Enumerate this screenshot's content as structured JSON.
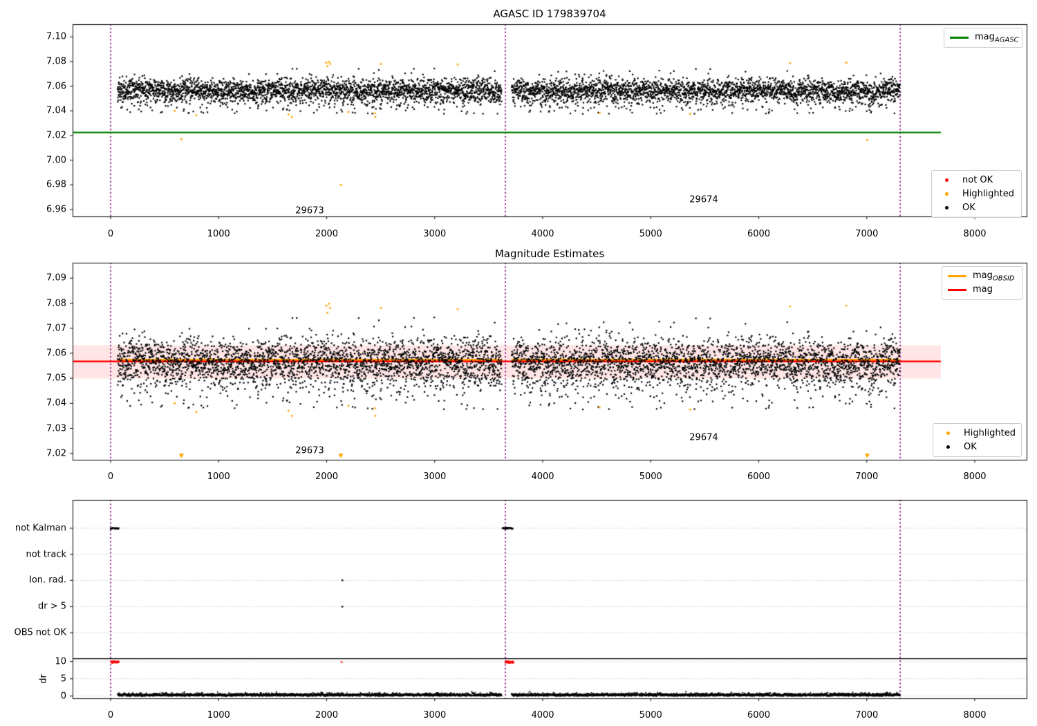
{
  "figure": {
    "titles": {
      "plot1": "AGASC ID 179839704",
      "plot2": "Magnitude Estimates"
    }
  },
  "colors": {
    "agasc_line": "#008000",
    "obsid_line": "#ffa500",
    "mag_line": "#ff0000",
    "vline": "#800080",
    "band": "rgba(255,0,0,0.10)",
    "ok_marker": "#000000",
    "highlighted_marker": "#ffa500",
    "not_ok_marker": "#ff0000",
    "grid": "#b0b0b0"
  },
  "chart_data": [
    {
      "type": "scatter",
      "title": "AGASC ID 179839704",
      "xlim": [
        -352,
        8480
      ],
      "ylim": [
        6.954,
        7.11
      ],
      "xticks": [
        0,
        1000,
        2000,
        3000,
        4000,
        5000,
        6000,
        7000,
        8000
      ],
      "xtick_labels": [
        "0",
        "1000",
        "2000",
        "3000",
        "4000",
        "5000",
        "6000",
        "7000",
        "8000"
      ],
      "yticks": [
        6.96,
        6.98,
        7.0,
        7.02,
        7.04,
        7.06,
        7.08,
        7.1
      ],
      "ytick_labels": [
        "6.96",
        "6.98",
        "7.00",
        "7.02",
        "7.04",
        "7.06",
        "7.08",
        "7.10"
      ],
      "ref_line": {
        "name": "mag_AGASC",
        "y": 7.0225,
        "x_start": -352,
        "x_end": 7686
      },
      "vlines": [
        0,
        3655,
        7310
      ],
      "obsid_annotations": [
        {
          "text": "29673",
          "x": 1843,
          "y": 6.959
        },
        {
          "text": "29674",
          "x": 5491,
          "y": 6.968
        }
      ],
      "scatter": {
        "mean": 7.0565,
        "sigma": 0.0048,
        "y_core_range": [
          7.045,
          7.068
        ],
        "segments": [
          {
            "obsid": "29673",
            "x_range": [
              64,
              3620
            ],
            "n": 2800
          },
          {
            "obsid": "29674",
            "x_range": [
              3712,
              7308
            ],
            "n": 2800
          }
        ]
      },
      "highlighted_points": [
        [
          593,
          7.04
        ],
        [
          655,
          7.017
        ],
        [
          794,
          7.0365
        ],
        [
          1647,
          7.037
        ],
        [
          1679,
          7.035
        ],
        [
          1997,
          7.079
        ],
        [
          2007,
          7.0762
        ],
        [
          2022,
          7.0798
        ],
        [
          2033,
          7.0781
        ],
        [
          2131,
          6.98
        ],
        [
          2202,
          7.039
        ],
        [
          2445,
          7.038
        ],
        [
          2451,
          7.035
        ],
        [
          2502,
          7.078
        ],
        [
          3213,
          7.0776
        ],
        [
          4527,
          7.0384
        ],
        [
          5365,
          7.0375
        ],
        [
          6290,
          7.0787
        ],
        [
          6810,
          7.079
        ],
        [
          7004,
          7.0163
        ]
      ],
      "legend_top": {
        "items": [
          {
            "swatch": "line",
            "color": "#008000",
            "label_main": "mag",
            "label_sub": "AGASC"
          }
        ]
      },
      "legend_bottom": {
        "items": [
          {
            "swatch": "dot",
            "color": "#ff0000",
            "label": "not OK"
          },
          {
            "swatch": "dot",
            "color": "#ffa500",
            "label": "Highlighted"
          },
          {
            "swatch": "dot",
            "color": "#000000",
            "label": "OK"
          }
        ]
      }
    },
    {
      "type": "scatter",
      "title": "Magnitude Estimates",
      "xlim": [
        -352,
        8480
      ],
      "ylim": [
        7.0174,
        7.0962
      ],
      "xticks": [
        0,
        1000,
        2000,
        3000,
        4000,
        5000,
        6000,
        7000,
        8000
      ],
      "xtick_labels": [
        "0",
        "1000",
        "2000",
        "3000",
        "4000",
        "5000",
        "6000",
        "7000",
        "8000"
      ],
      "yticks": [
        7.02,
        7.03,
        7.04,
        7.05,
        7.06,
        7.07,
        7.08,
        7.09
      ],
      "ytick_labels": [
        "7.02",
        "7.03",
        "7.04",
        "7.05",
        "7.06",
        "7.07",
        "7.08",
        "7.09"
      ],
      "mag_line": {
        "name": "mag",
        "y": 7.0567,
        "x_start": -352,
        "x_end": 7686
      },
      "obsid_line": {
        "name": "mag_OBSID",
        "y": 7.0572,
        "segments": [
          [
            64,
            3620
          ],
          [
            3712,
            7308
          ]
        ]
      },
      "band": {
        "y_low": 7.0499,
        "y_high": 7.0632,
        "x_start": -352,
        "x_end": 7686
      },
      "vlines": [
        0,
        3655,
        7310
      ],
      "obsid_annotations": [
        {
          "text": "29673",
          "x": 1843,
          "y": 7.021
        },
        {
          "text": "29674",
          "x": 5491,
          "y": 7.0263
        }
      ],
      "clipped_low_x": [
        655,
        2131,
        7004
      ],
      "legend_top": {
        "items": [
          {
            "swatch": "line",
            "color": "#ffa500",
            "label_main": "mag",
            "label_sub": "OBSID"
          },
          {
            "swatch": "line",
            "color": "#ff0000",
            "label_main": "mag",
            "label_sub": ""
          }
        ]
      },
      "legend_bottom": {
        "items": [
          {
            "swatch": "dot",
            "color": "#ffa500",
            "label": "Highlighted"
          },
          {
            "swatch": "dot",
            "color": "#000000",
            "label": "OK"
          }
        ]
      }
    },
    {
      "type": "flags-and-dr",
      "rows": [
        {
          "label": "not Kalman"
        },
        {
          "label": "not track"
        },
        {
          "label": "Ion. rad."
        },
        {
          "label": "dr > 5"
        },
        {
          "label": "OBS not OK"
        }
      ],
      "dr_ticks": [
        {
          "value": 10,
          "label": "10"
        },
        {
          "value": 5,
          "label": "5"
        },
        {
          "value": 0,
          "label": "0"
        }
      ],
      "ylabel": "dr",
      "xticks": [
        0,
        1000,
        2000,
        3000,
        4000,
        5000,
        6000,
        7000,
        8000
      ],
      "xtick_labels": [
        "0",
        "1000",
        "2000",
        "3000",
        "4000",
        "5000",
        "6000",
        "7000",
        "8000"
      ],
      "vlines": [
        0,
        3655,
        7310
      ],
      "separator_dr": 10.8,
      "events": {
        "not_kalman_ranges": [
          [
            0,
            75
          ],
          [
            3628,
            3722
          ]
        ],
        "ion_rad_x": [
          2145
        ],
        "dr_gt5_x": [
          2145
        ],
        "dr10_red_ranges": [
          [
            5,
            75
          ],
          [
            3655,
            3730
          ]
        ],
        "dr10_red_single_x": [
          2138
        ]
      },
      "dr_trace": {
        "segments": [
          [
            64,
            3620
          ],
          [
            3712,
            7308
          ]
        ],
        "min": 0,
        "max": 1.45,
        "typical": 0.4
      }
    }
  ]
}
